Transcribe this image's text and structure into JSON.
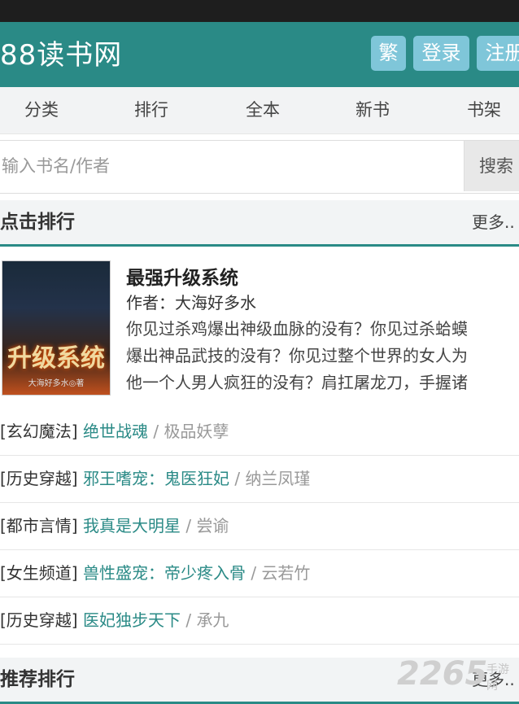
{
  "header": {
    "logo": "88读书网",
    "btn_trad": "繁",
    "btn_login": "登录",
    "btn_register": "注册"
  },
  "nav": [
    "分类",
    "排行",
    "全本",
    "新书",
    "书架"
  ],
  "search": {
    "placeholder": "输入书名/作者",
    "button": "搜索"
  },
  "click_rank": {
    "title": "点击排行",
    "more": "更多..",
    "featured": {
      "title": "最强升级系统",
      "author": "作者：大海好多水",
      "desc_lines": [
        "你见过杀鸡爆出神级血脉的没有？你见过杀蛤蟆",
        "爆出神品武技的没有？你见过整个世界的女人为",
        "他一个人男人疯狂的没有？肩扛屠龙刀，手握诸"
      ],
      "cover_text": "升级系统",
      "cover_author": "大海好多水◎著"
    },
    "items": [
      {
        "cat": "[玄幻魔法]",
        "name": "绝世战魂",
        "author": "极品妖孽"
      },
      {
        "cat": "[历史穿越]",
        "name": "邪王嗜宠：鬼医狂妃",
        "author": "纳兰凤瑾"
      },
      {
        "cat": "[都市言情]",
        "name": "我真是大明星",
        "author": "尝谕"
      },
      {
        "cat": "[女生频道]",
        "name": "兽性盛宠：帝少疼入骨",
        "author": "云若竹"
      },
      {
        "cat": "[历史穿越]",
        "name": "医妃独步天下",
        "author": "承九"
      }
    ]
  },
  "recommend_rank": {
    "title": "推荐排行",
    "more": "更多.."
  },
  "watermark": {
    "brand": "2265",
    "sub": "手游网"
  },
  "colors": {
    "primary": "#2a8a86",
    "button": "#7fc6d9",
    "link": "#2a8a86"
  }
}
